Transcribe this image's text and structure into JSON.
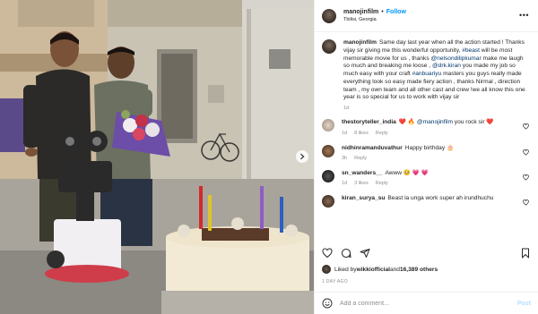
{
  "header": {
    "username": "manojinfilm",
    "follow_label": "Follow",
    "location": "Tbilisi, Georgia",
    "more_icon": "more-icon"
  },
  "caption": {
    "username": "manojinfilm",
    "text_1": "Same day last year when all the action started ! Thanks vijay sir giving me this wonderful opportunity, ",
    "hashtag_beast": "#beast",
    "text_2": " will be most memorable movie for us , thanks ",
    "mention_nelson": "@nelsondilipkumar",
    "text_3": " make me laugh so much and breaking me loose , ",
    "mention_kiran": "@drk.kiran",
    "text_4": " you made my job so much easy with your craft ",
    "hashtag_anbu": "#anbuariyu",
    "text_5": " masters you guys really made everything look so easy made fiery action , thanks Nirmal , direction team , my own team and all other cast and crew !we all know this one year is so special for us to work with vijay sir",
    "time": "1d"
  },
  "comments": [
    {
      "username": "thestoryteller_india",
      "text_pre": "❤️ 🔥 ",
      "mention": "@manojinfilm",
      "text_post": " you rock sir ❤️",
      "time": "1d",
      "likes": "8 likes",
      "reply": "Reply"
    },
    {
      "username": "nidhinramanduvathur",
      "text_pre": "Happy birthday 🎂",
      "mention": "",
      "text_post": "",
      "time": "3h",
      "likes": "",
      "reply": "Reply"
    },
    {
      "username": "sn_wanders__",
      "text_pre": "Awww 🥺 💗 💗",
      "mention": "",
      "text_post": "",
      "time": "1d",
      "likes": "3 likes",
      "reply": "Reply"
    },
    {
      "username": "kiran_surya_su",
      "text_pre": "Beast la unga work super ah irundhuchu",
      "mention": "",
      "text_post": "",
      "time": "",
      "likes": "",
      "reply": ""
    }
  ],
  "likes": {
    "prefix": "Liked by ",
    "user": "wikkiofficial",
    "middle": " and ",
    "count": "16,389 others"
  },
  "date": "1 DAY AGO",
  "add_comment": {
    "placeholder": "Add a comment...",
    "post_label": "Post"
  },
  "colors": {
    "accent": "#0095f6",
    "mention": "#00376b",
    "muted": "#8e8e8e",
    "like_red": "#ed4956"
  }
}
